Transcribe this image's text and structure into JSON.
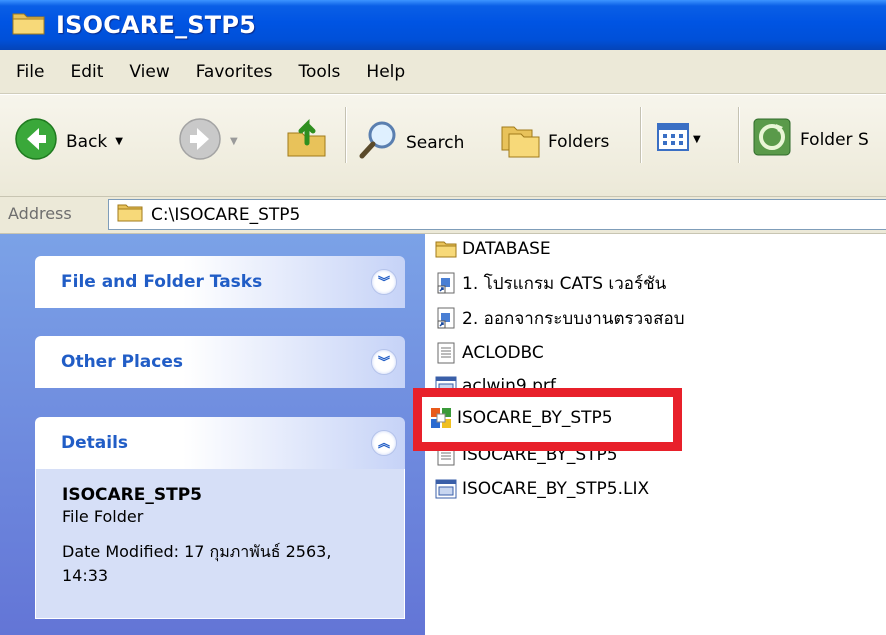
{
  "window": {
    "title": "ISOCARE_STP5"
  },
  "menu": [
    "File",
    "Edit",
    "View",
    "Favorites",
    "Tools",
    "Help"
  ],
  "toolbar": {
    "back_label": "Back",
    "search_label": "Search",
    "folders_label": "Folders",
    "folder_sync_label": "Folder S"
  },
  "address": {
    "label": "Address",
    "path": "C:\\ISOCARE_STP5"
  },
  "taskpane": {
    "file_tasks_title": "File and Folder Tasks",
    "other_places_title": "Other Places",
    "details_title": "Details",
    "details": {
      "name": "ISOCARE_STP5",
      "type": "File Folder",
      "date_modified": "Date Modified: 17 กุมภาพันธ์ 2563, 14:33"
    }
  },
  "files": [
    {
      "name": "DATABASE",
      "icon": "folder-icon"
    },
    {
      "name": "1. โปรแกรม CATS เวอร์ชัน",
      "icon": "shortcut-icon"
    },
    {
      "name": "2. ออกจากระบบงานตรวจสอบ",
      "icon": "shortcut-icon"
    },
    {
      "name": "ACLODBC",
      "icon": "text-file-icon"
    },
    {
      "name": "aclwin9.prf",
      "icon": "app-file-icon"
    },
    {
      "name": "ISOCARE_BY_STP5",
      "icon": "application-icon"
    },
    {
      "name": "ISOCARE_BY_STP5",
      "icon": "text-file-icon"
    },
    {
      "name": "ISOCARE_BY_STP5.LIX",
      "icon": "app-file-icon"
    }
  ],
  "colors": {
    "title_blue": "#0054e3",
    "pane_blue": "#6f8fdf",
    "link_blue": "#215dc6",
    "highlight_red": "#e8202a"
  }
}
